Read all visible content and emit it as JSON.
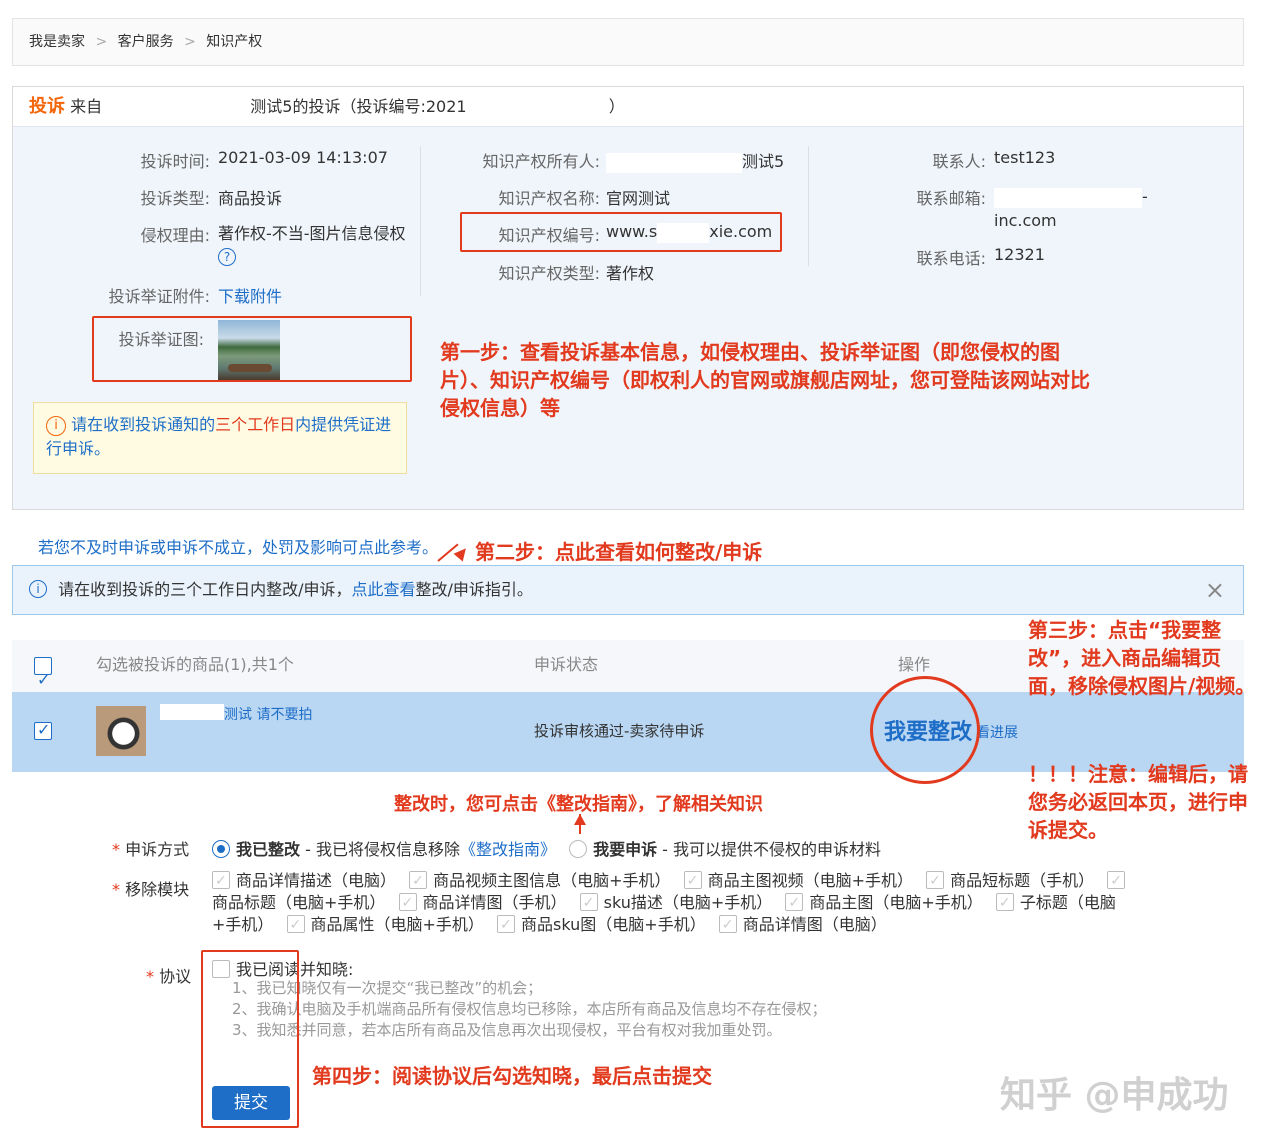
{
  "breadcrumb": {
    "items": [
      "我是卖家",
      "客户服务",
      "知识产权"
    ],
    "sep": ">"
  },
  "complaint": {
    "title_tag": "投诉",
    "title_from": "来自",
    "title_name": "测试5的投诉（投诉编号:2021",
    "title_end": "）",
    "time_label": "投诉时间:",
    "time_value": "2021-03-09 14:13:07",
    "type_label": "投诉类型:",
    "type_value": "商品投诉",
    "reason_label": "侵权理由:",
    "reason_value": "著作权-不当-图片信息侵权",
    "attach_label": "投诉举证附件:",
    "attach_value": "下载附件",
    "image_label": "投诉举证图:",
    "owner_label": "知识产权所有人:",
    "owner_value": "测试5",
    "ipname_label": "知识产权名称:",
    "ipname_value": "官网测试",
    "ipno_label": "知识产权编号:",
    "ipno_value_a": "www.s",
    "ipno_value_b": "xie.com",
    "iptype_label": "知识产权类型:",
    "iptype_value": "著作权",
    "contact_label": "联系人:",
    "contact_value": "test123",
    "email_label": "联系邮箱:",
    "email_value_a": "-",
    "email_value_b": "inc.com",
    "phone_label": "联系电话:",
    "phone_value": "12321",
    "notice_a": "请在收到投诉通知的",
    "notice_b": "三个工作日",
    "notice_c": "内提供凭证进行申诉。"
  },
  "ref_link": "若您不及时申诉或申诉不成立，处罚及影响可点此参考。",
  "banner": {
    "text_a": "请在收到投诉的三个工作日内整改/申诉，",
    "link": "点此查看",
    "text_b": "整改/申诉指引。",
    "close": "×"
  },
  "table": {
    "col_goods": "勾选被投诉的商品(1),共1个",
    "col_status": "申诉状态",
    "col_action": "操作",
    "row": {
      "name": "测试 请不要拍",
      "status": "投诉审核通过-卖家待申诉",
      "action": "我要整改",
      "progress": "看进展"
    }
  },
  "form": {
    "star": "*",
    "method_label": "申诉方式",
    "opt1_bold": "我已整改",
    "opt1_desc": " - 我已将侵权信息移除",
    "opt1_link": "《整改指南》",
    "opt2_bold": "我要申诉",
    "opt2_desc": " - 我可以提供不侵权的申诉材料",
    "module_label": "移除模块",
    "modules": [
      "商品详情描述（电脑）",
      "商品视频主图信息（电脑+手机）",
      "商品主图视频（电脑+手机）",
      "商品短标题（手机）",
      "商品标题（电脑+手机）",
      "商品详情图（手机）",
      "sku描述（电脑+手机）",
      "商品主图（电脑+手机）",
      "子标题（电脑+手机）",
      "商品属性（电脑+手机）",
      "商品sku图（电脑+手机）",
      "商品详情图（电脑）"
    ],
    "agree_label": "协议",
    "agree_title": "我已阅读并知晓:",
    "agree_1": "1、我已知晓仅有一次提交“我已整改”的机会；",
    "agree_2": "2、我确认电脑及手机端商品所有侵权信息均已移除，本店所有商品及信息均不存在侵权；",
    "agree_3": "3、我知悉并同意，若本店所有商品及信息再次出现侵权，平台有权对我加重处罚。",
    "submit": "提交"
  },
  "annotations": {
    "step1": "第一步：查看投诉基本信息，如侵权理由、投诉举证图（即您侵权的图片）、知识产权编号（即权利人的官网或旗舰店网址，您可登陆该网站对比侵权信息）等",
    "step2": "第二步：点此查看如何整改/申诉",
    "step3": "第三步：点击“我要整改”，进入商品编辑页面，移除侵权图片/视频。",
    "step3_note": "！！！注意：编辑后，请您务必返回本页，进行申诉提交。",
    "guide": "整改时，您可点击《整改指南》，了解相关知识",
    "step4": "第四步：阅读协议后勾选知晓，最后点击提交"
  },
  "watermark": "知乎 @申成功",
  "colors": {
    "annotation_red": "#e23a1e",
    "link_blue": "#1e6ec8",
    "accent_orange": "#f5650a",
    "row_blue": "#b9d6f2"
  }
}
